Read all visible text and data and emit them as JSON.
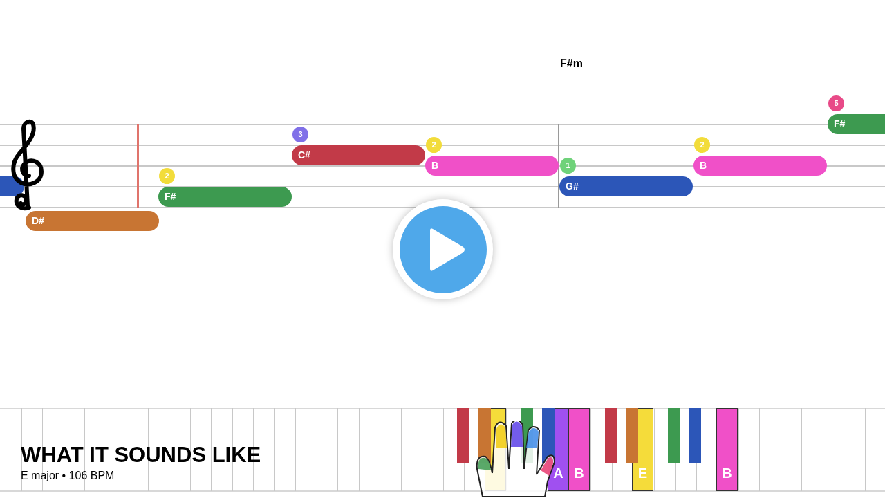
{
  "chord": "F#m",
  "notes": [
    {
      "color": "#2c56b8"
    },
    {
      "label": "D#",
      "color": "#c87533"
    },
    {
      "label": "F#",
      "color": "#3d9a50",
      "finger": {
        "number": "2",
        "color": "#f2dc3a"
      }
    },
    {
      "label": "C#",
      "color": "#c23a48",
      "finger": {
        "number": "3",
        "color": "#8070e8"
      }
    },
    {
      "label": "B",
      "color": "#f050c8",
      "finger": {
        "number": "2",
        "color": "#f2dc3a"
      }
    },
    {
      "label": "G#",
      "color": "#2c56b8",
      "finger": {
        "number": "1",
        "color": "#6fd27a"
      }
    },
    {
      "label": "B",
      "color": "#f050c8",
      "finger": {
        "number": "2",
        "color": "#f2dc3a"
      }
    },
    {
      "label": "F#",
      "color": "#3d9a50",
      "finger": {
        "number": "5",
        "color": "#e84a88"
      }
    }
  ],
  "sharp_keys": [
    {
      "color": "#c23a48"
    },
    {
      "color": "#c87533"
    },
    {
      "color": "#3d9a50"
    },
    {
      "color": "#2c56b8"
    },
    {
      "color": "#c23a48"
    },
    {
      "color": "#c87533"
    },
    {
      "color": "#3d9a50"
    },
    {
      "color": "#2c56b8"
    }
  ],
  "natural_keys": [
    {
      "color": "#f5dc3a"
    },
    {
      "label": "A",
      "color": "#a050f0"
    },
    {
      "label": "B",
      "color": "#f050c8"
    },
    {
      "label": "E",
      "color": "#f5dc3a"
    },
    {
      "label": "B",
      "color": "#f050c8"
    }
  ],
  "song": {
    "title": "WHAT IT SOUNDS LIKE",
    "subtitle": "E major • 106 BPM"
  }
}
